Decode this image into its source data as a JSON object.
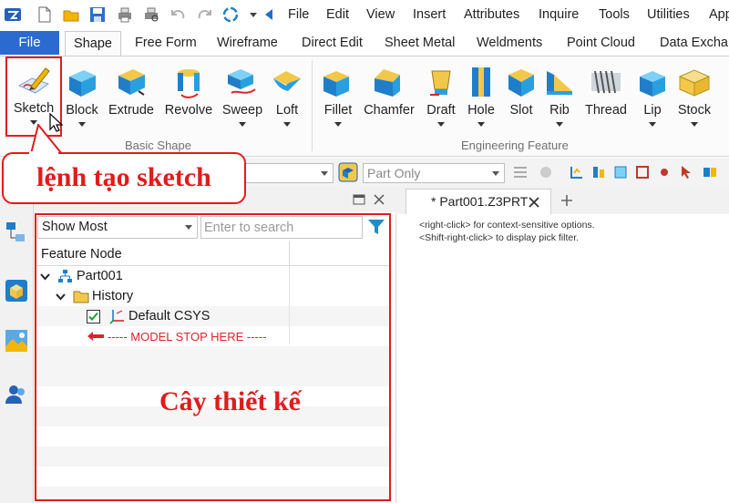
{
  "menu": [
    "File",
    "Edit",
    "View",
    "Insert",
    "Attributes",
    "Inquire",
    "Tools",
    "Utilities",
    "App"
  ],
  "ribbon_tabs": [
    "File",
    "Shape",
    "Free Form",
    "Wireframe",
    "Direct Edit",
    "Sheet Metal",
    "Weldments",
    "Point Cloud",
    "Data Exchar"
  ],
  "active_tab": "Shape",
  "ribbon": {
    "basic_shape": {
      "group_label": "Basic Shape",
      "buttons": [
        "Sketch",
        "Block",
        "Extrude",
        "Revolve",
        "Sweep",
        "Loft"
      ]
    },
    "engineering_feature": {
      "group_label": "Engineering Feature",
      "buttons": [
        "Fillet",
        "Chamfer",
        "Draft",
        "Hole",
        "Slot",
        "Rib",
        "Thread",
        "Lip",
        "Stock"
      ]
    }
  },
  "toolbar": {
    "filter_value": "Part Only"
  },
  "tree_panel": {
    "filter_select": "Show Most",
    "search_placeholder": "Enter to search",
    "column_header": "Feature Node",
    "nodes": {
      "root": "Part001",
      "history": "History",
      "csys": "Default CSYS",
      "stop": "----- MODEL STOP HERE -----"
    }
  },
  "document": {
    "tab_title": "* Part001.Z3PRT",
    "hints": [
      "<right-click> for context-sensitive options.",
      "<Shift-right-click> to display pick filter."
    ]
  },
  "annotations": {
    "sketch_callout": "lệnh tạo sketch",
    "tree_callout": "Cây thiết kế"
  },
  "colors": {
    "file_tab": "#2b6bd0",
    "annotation_red": "#e21b1b",
    "icon_blue": "#1f7ec9",
    "icon_yellow": "#f2b705"
  }
}
